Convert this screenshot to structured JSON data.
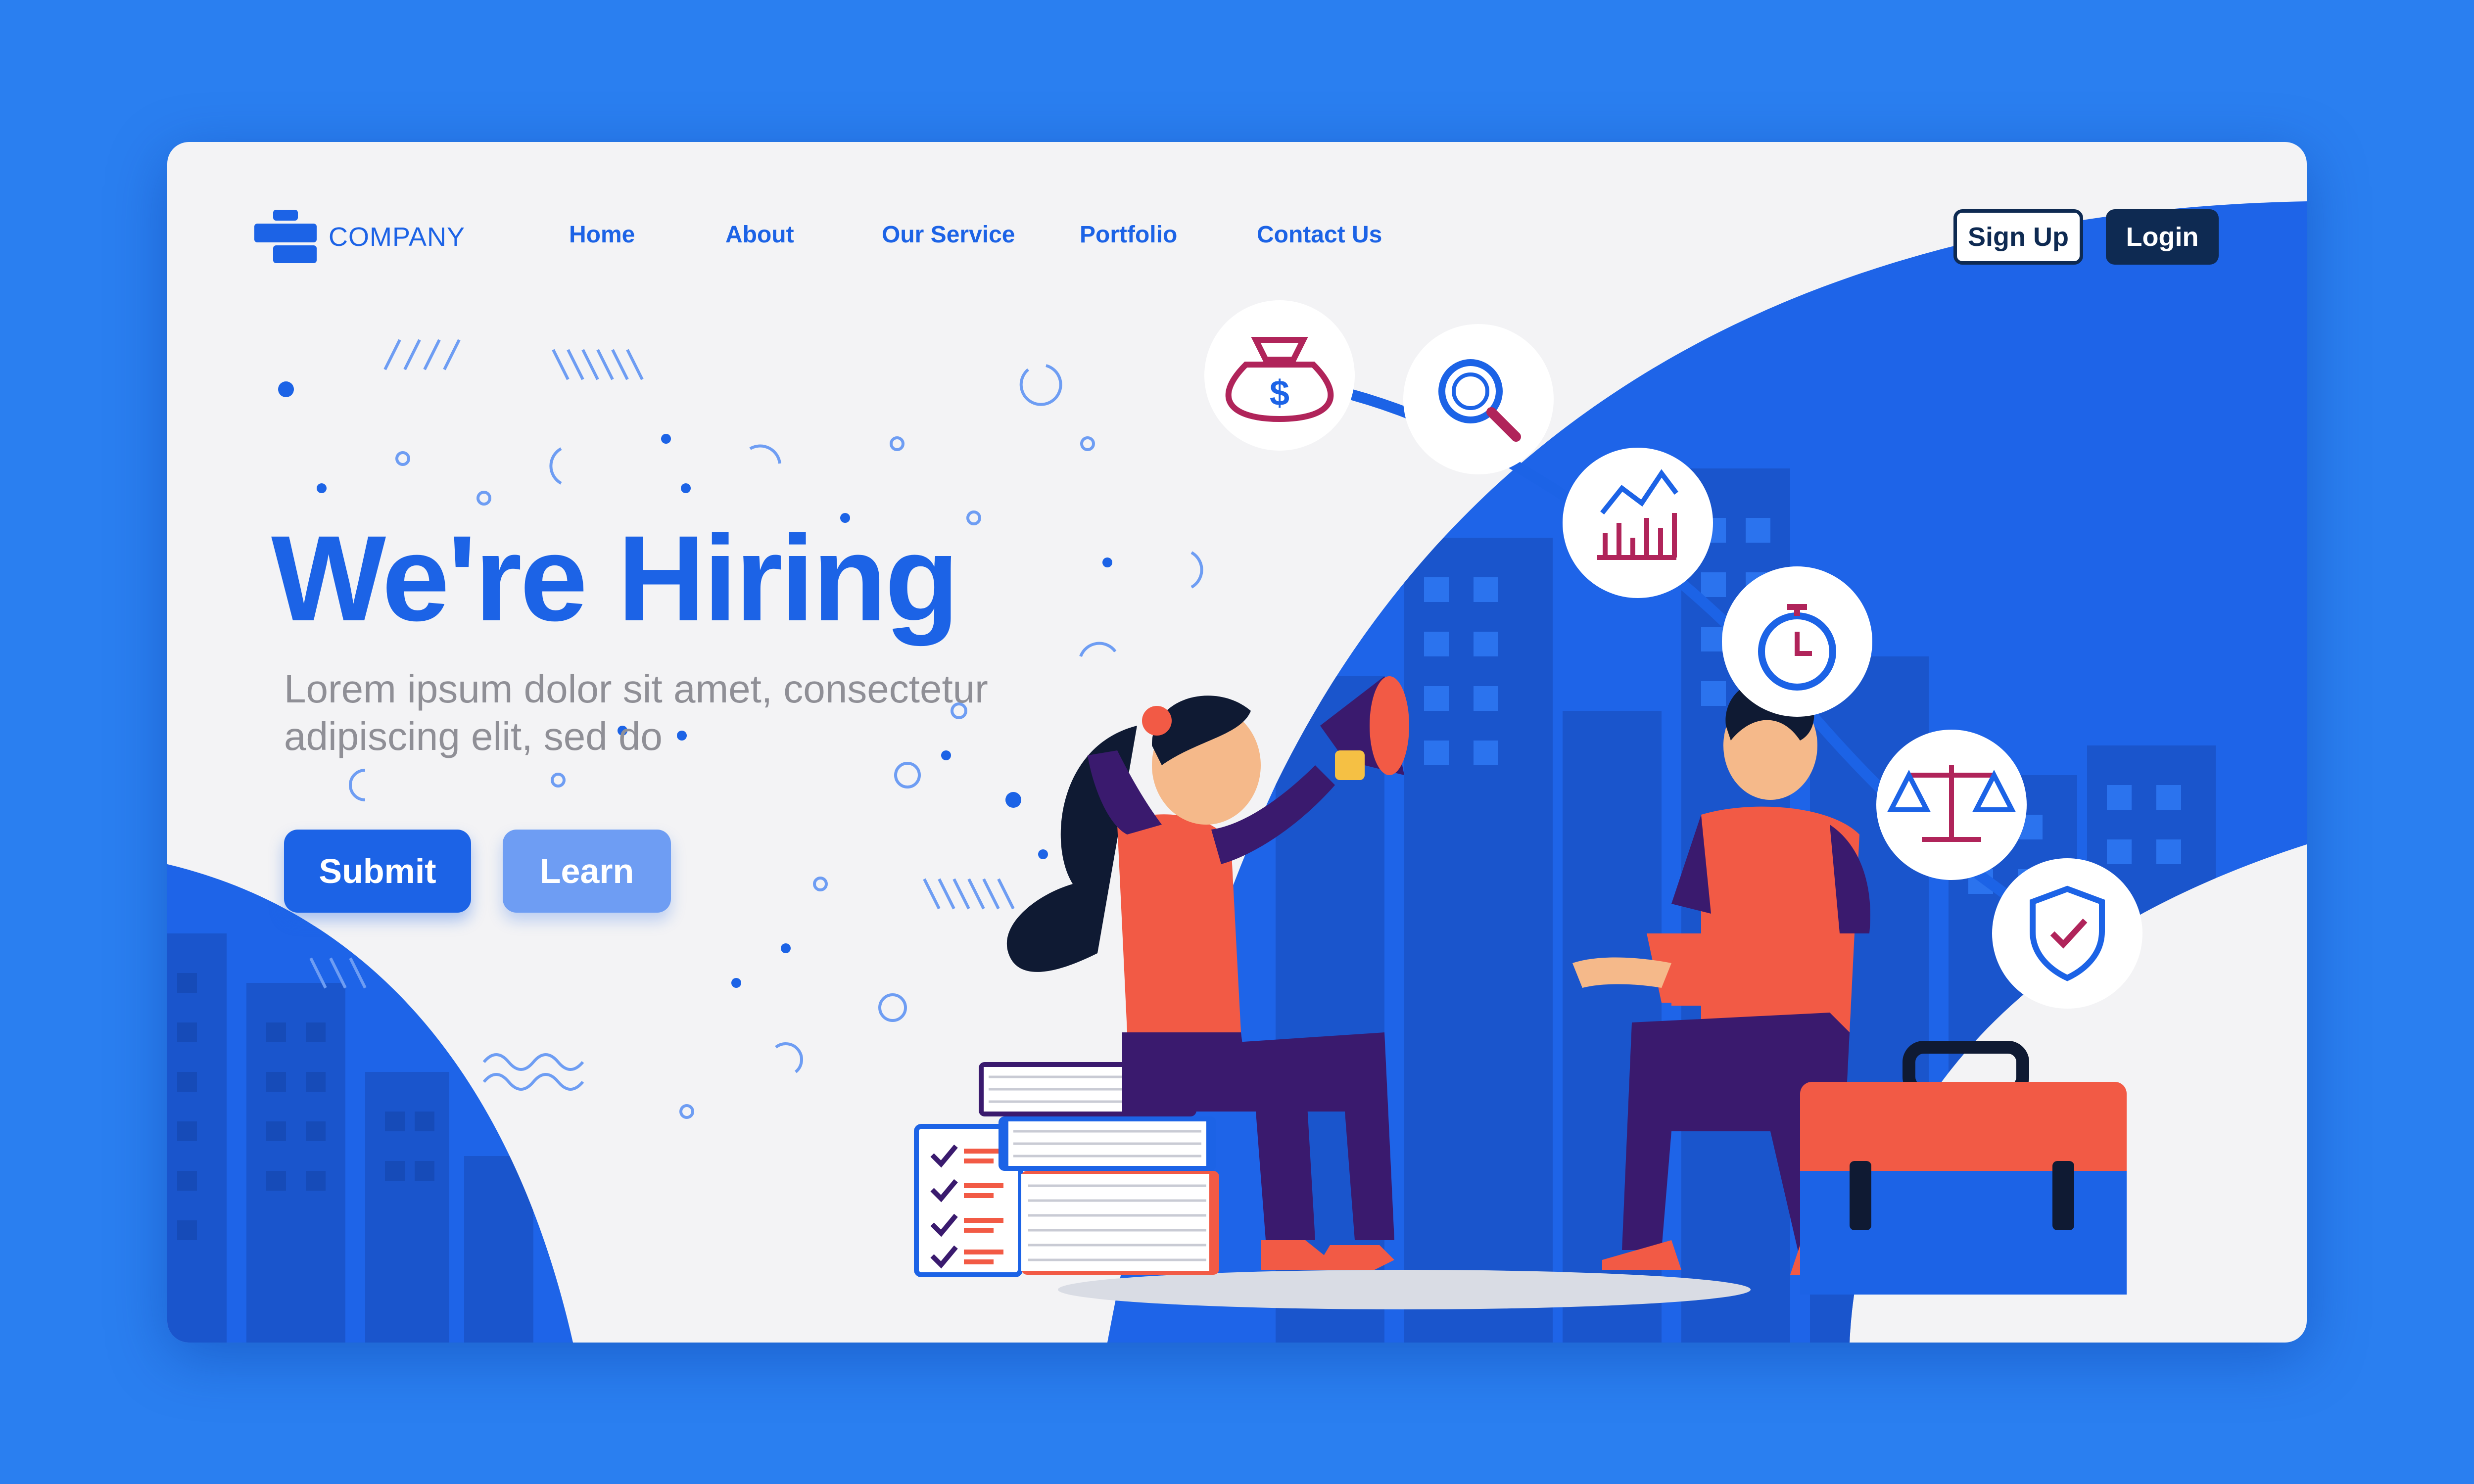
{
  "brand": {
    "name": "COMPANY"
  },
  "nav": {
    "links": [
      "Home",
      "About",
      "Our Service",
      "Portfolio",
      "Contact Us"
    ]
  },
  "auth": {
    "signup_label": "Sign Up",
    "login_label": "Login"
  },
  "hero": {
    "title": "We're Hiring",
    "subtitle": "Lorem ipsum dolor sit amet, consectetur adipiscing elit, sed do",
    "submit_label": "Submit",
    "learn_label": "Learn"
  },
  "feature_icons": [
    "money-bag-icon",
    "magnifier-icon",
    "bar-chart-icon",
    "stopwatch-icon",
    "balance-scale-icon",
    "shield-check-icon"
  ],
  "colors": {
    "page_background": "#2a7ff0",
    "card_background": "#f3f3f5",
    "primary": "#1c63e6",
    "light_button": "#6e9df3",
    "dark_button": "#0e2a52",
    "subtitle_text": "#8f8f96",
    "accent_red": "#f25a45",
    "deep_purple": "#3a1a6e"
  }
}
